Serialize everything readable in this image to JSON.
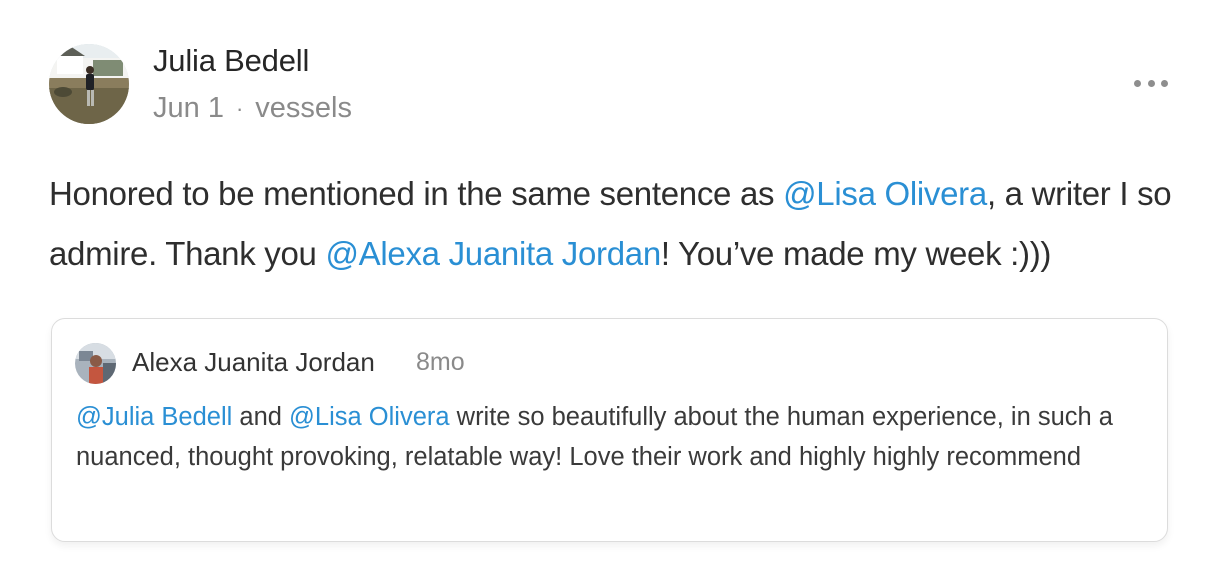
{
  "post": {
    "author_name": "Julia Bedell",
    "date": "Jun 1",
    "separator": "·",
    "publication": "vessels",
    "more_menu_icon": "ellipsis-icon",
    "body": {
      "part1": "Honored to be mentioned in the same sentence as ",
      "mention1": "@Lisa Olivera",
      "part2": ", a writer I so admire. Thank you ",
      "mention2": "@Alexa Juanita Jordan",
      "part3": "! You’ve made my week :)))"
    }
  },
  "quoted_note": {
    "author_name": "Alexa Juanita Jordan",
    "time_ago": "8mo",
    "body": {
      "mention1": "@Julia Bedell",
      "part1": " and ",
      "mention2": "@Lisa Olivera",
      "part2": " write so beautifully about the human experience, in such a nuanced, thought provoking, relatable way! Love their work and highly highly recommend"
    }
  },
  "colors": {
    "mention": "#2a8fd4",
    "meta": "#8a8a8a",
    "text": "#2e2e2e",
    "card_border": "#dcdcdc"
  }
}
